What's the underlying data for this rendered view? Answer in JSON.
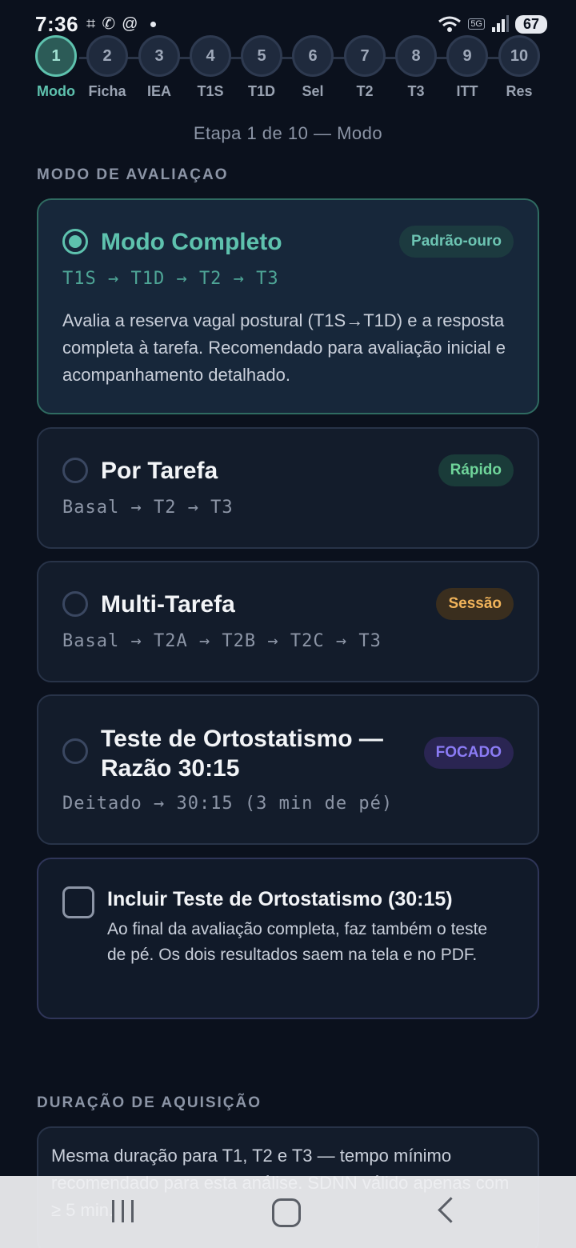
{
  "status_bar": {
    "time": "7:36",
    "network": "5G",
    "battery": "67",
    "icons": [
      "screenshot-icon",
      "whatsapp-icon",
      "threads-icon",
      "wifi-icon",
      "signal-icon"
    ]
  },
  "stepper": {
    "steps": [
      {
        "number": "1",
        "label": "Modo"
      },
      {
        "number": "2",
        "label": "Ficha"
      },
      {
        "number": "3",
        "label": "IEA"
      },
      {
        "number": "4",
        "label": "T1S"
      },
      {
        "number": "5",
        "label": "T1D"
      },
      {
        "number": "6",
        "label": "Sel"
      },
      {
        "number": "7",
        "label": "T2"
      },
      {
        "number": "8",
        "label": "T3"
      },
      {
        "number": "9",
        "label": "ITT"
      },
      {
        "number": "10",
        "label": "Res"
      }
    ],
    "active_index": 0,
    "progress_text": "Etapa 1 de 10 — Modo"
  },
  "mode_section": {
    "title": "MODO DE AVALIAÇAO",
    "options": [
      {
        "title": "Modo Completo",
        "badge": "Padrão-ouro",
        "flow": "T1S → T1D → T2 → T3",
        "description": "Avalia a reserva vagal postural (T1S→T1D) e a resposta completa à tarefa. Recomendado para avaliação inicial e acompanhamento detalhado.",
        "selected": true
      },
      {
        "title": "Por Tarefa",
        "badge": "Rápido",
        "flow": "Basal → T2 → T3",
        "selected": false
      },
      {
        "title": "Multi-Tarefa",
        "badge": "Sessão",
        "flow": "Basal → T2A → T2B → T2C → T3",
        "selected": false
      },
      {
        "title_line1": "Teste de Ortostatismo —",
        "title_line2": "Razão 30:15",
        "badge": "FOCADO",
        "flow": "Deitado → 30:15 (3 min de pé)",
        "selected": false
      }
    ],
    "include_orthostatic": {
      "label": "Incluir Teste de Ortostatismo (30:15)",
      "description": "Ao final da avaliação completa, faz também o teste de pé. Os dois resultados saem na tela e no PDF.",
      "checked": false
    }
  },
  "duration_section": {
    "title": "DURAÇÃO DE AQUISIÇÃO",
    "text": "Mesma duração para T1, T2 e T3 — tempo mínimo recomendado para esta análise. SDNN válido apenas com ≥ 5 min."
  },
  "colors": {
    "accent": "#5ec2ae",
    "background": "#0b111d",
    "card": "#131c2b",
    "badge_fast": "#6fd59a",
    "badge_session": "#f0b35a",
    "badge_focus": "#8b7bf5"
  }
}
